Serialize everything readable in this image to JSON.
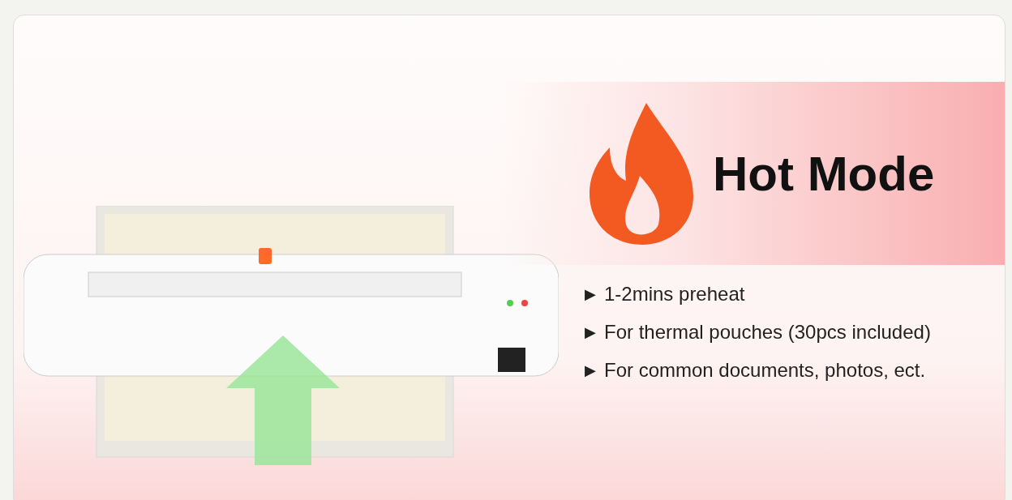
{
  "heading": "Hot Mode",
  "bullets": [
    {
      "marker": "▶",
      "text": "1-2mins preheat"
    },
    {
      "marker": "▶",
      "text": "For thermal pouches (30pcs included)"
    },
    {
      "marker": "▶",
      "text": "For common documents, photos, ect."
    }
  ]
}
